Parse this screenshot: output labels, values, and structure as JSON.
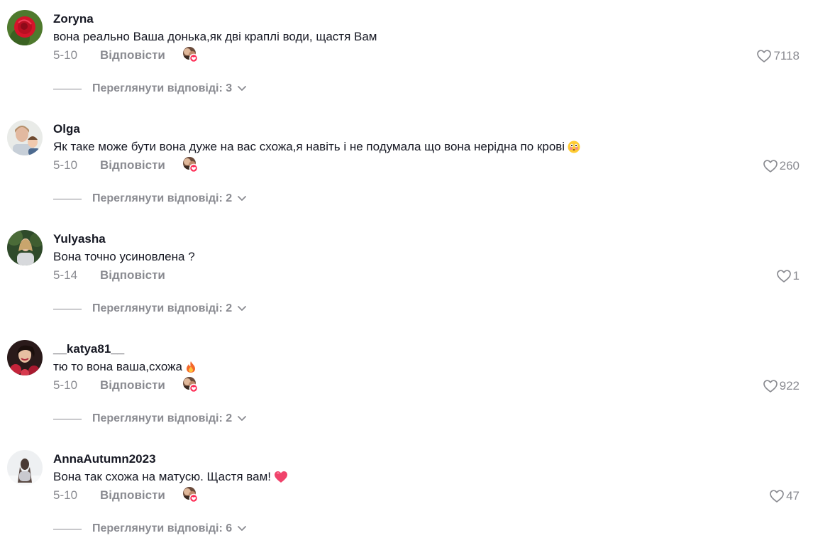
{
  "comments": [
    {
      "username": "Zoryna",
      "text": "вона реально Ваша донька,як дві краплі води, щастя Вам",
      "emoji": "",
      "date": "5-10",
      "reply_label": "Відповісти",
      "creator_liked": true,
      "likes": "7118",
      "view_replies": "Переглянути відповіді: 3",
      "avatar": "red-rose-photo"
    },
    {
      "username": "Olga",
      "text": "Як таке може бути вона дуже на вас схожа,я навіть і не подумала що вона нерідна по крові",
      "emoji": "flushed-face-emoji",
      "date": "5-10",
      "reply_label": "Відповісти",
      "creator_liked": true,
      "likes": "260",
      "view_replies": "Переглянути відповіді: 2",
      "avatar": "mother-child-photo"
    },
    {
      "username": "Yulyasha",
      "text": "Вона точно усиновлена ?",
      "emoji": "",
      "date": "5-14",
      "reply_label": "Відповісти",
      "creator_liked": false,
      "likes": "1",
      "view_replies": "Переглянути відповіді: 2",
      "avatar": "woman-outdoor-photo"
    },
    {
      "username": "__katya81__",
      "text": "тю то вона ваша,схожа",
      "emoji": "fire-emoji",
      "date": "5-10",
      "reply_label": "Відповісти",
      "creator_liked": true,
      "likes": "922",
      "view_replies": "Переглянути відповіді: 2",
      "avatar": "woman-flowers-photo"
    },
    {
      "username": "AnnaAutumn2023",
      "text": "Вона так схожа на матусю. Щастя вам!",
      "emoji": "heart-emoji",
      "date": "5-10",
      "reply_label": "Відповісти",
      "creator_liked": true,
      "likes": "47",
      "view_replies": "Переглянути відповіді: 6",
      "avatar": "girl-winter-photo"
    }
  ],
  "colors": {
    "text": "#161823",
    "muted": "#8a8b91",
    "creator_badge": "#fe2c55"
  }
}
